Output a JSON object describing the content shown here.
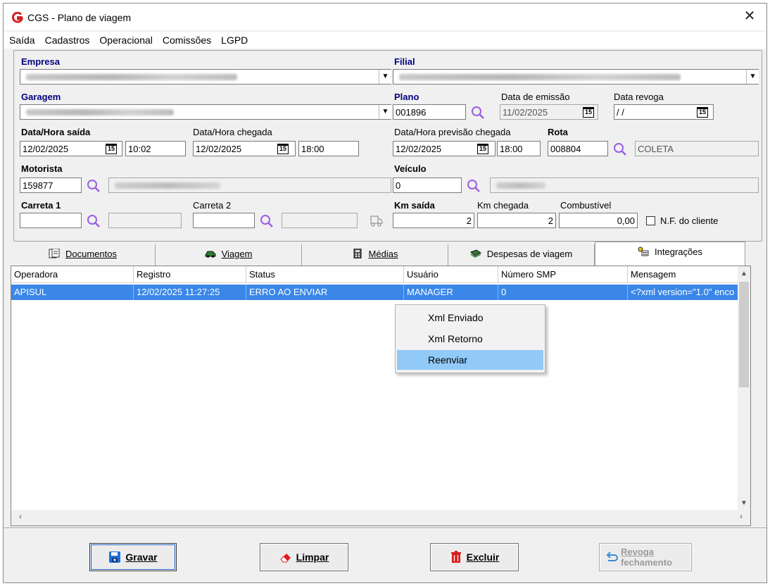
{
  "window": {
    "title": "CGS - Plano de viagem"
  },
  "menu": [
    "Saída",
    "Cadastros",
    "Operacional",
    "Comissões",
    "LGPD"
  ],
  "form": {
    "empresa_label": "Empresa",
    "filial_label": "Filial",
    "garagem_label": "Garagem",
    "plano_label": "Plano",
    "plano_value": "001896",
    "data_emissao_label": "Data de emissão",
    "data_emissao_value": "11/02/2025",
    "data_revoga_label": "Data revoga",
    "data_revoga_value": " / /",
    "data_hora_saida_label": "Data/Hora saída",
    "saida_date": "12/02/2025",
    "saida_time": "10:02",
    "data_hora_chegada_label": "Data/Hora chegada",
    "chegada_date": "12/02/2025",
    "chegada_time": "18:00",
    "previsao_label": "Data/Hora previsão chegada",
    "previsao_date": "12/02/2025",
    "previsao_time": "18:00",
    "rota_label": "Rota",
    "rota_value": "008804",
    "rota_desc": "COLETA",
    "motorista_label": "Motorista",
    "motorista_value": "159877",
    "veiculo_label": "Veículo",
    "veiculo_value": "0",
    "carreta1_label": "Carreta 1",
    "carreta2_label": "Carreta 2",
    "km_saida_label": "Km saída",
    "km_saida_value": "2",
    "km_chegada_label": "Km chegada",
    "km_chegada_value": "2",
    "combustivel_label": "Combustível",
    "combustivel_value": "0,00",
    "nf_cliente_label": "N.F. do cliente"
  },
  "tabs": [
    "Documentos",
    "Viagem",
    "Médias",
    "Despesas de viagem",
    "Integrações"
  ],
  "grid": {
    "columns": [
      "Operadora",
      "Registro",
      "Status",
      "Usuário",
      "Número SMP",
      "Mensagem"
    ],
    "rows": [
      [
        "APISUL",
        "12/02/2025 11:27:25",
        "ERRO AO ENVIAR",
        "MANAGER",
        "0",
        "<?xml version=\"1.0\" enco"
      ]
    ]
  },
  "context_menu": [
    "Xml Enviado",
    "Xml Retorno",
    "Reenviar"
  ],
  "buttons": {
    "gravar": "Gravar",
    "limpar": "Limpar",
    "excluir": "Excluir",
    "revoga_line1": "Revoga",
    "revoga_line2": "fechamento"
  },
  "calendar_icon_text": "15"
}
